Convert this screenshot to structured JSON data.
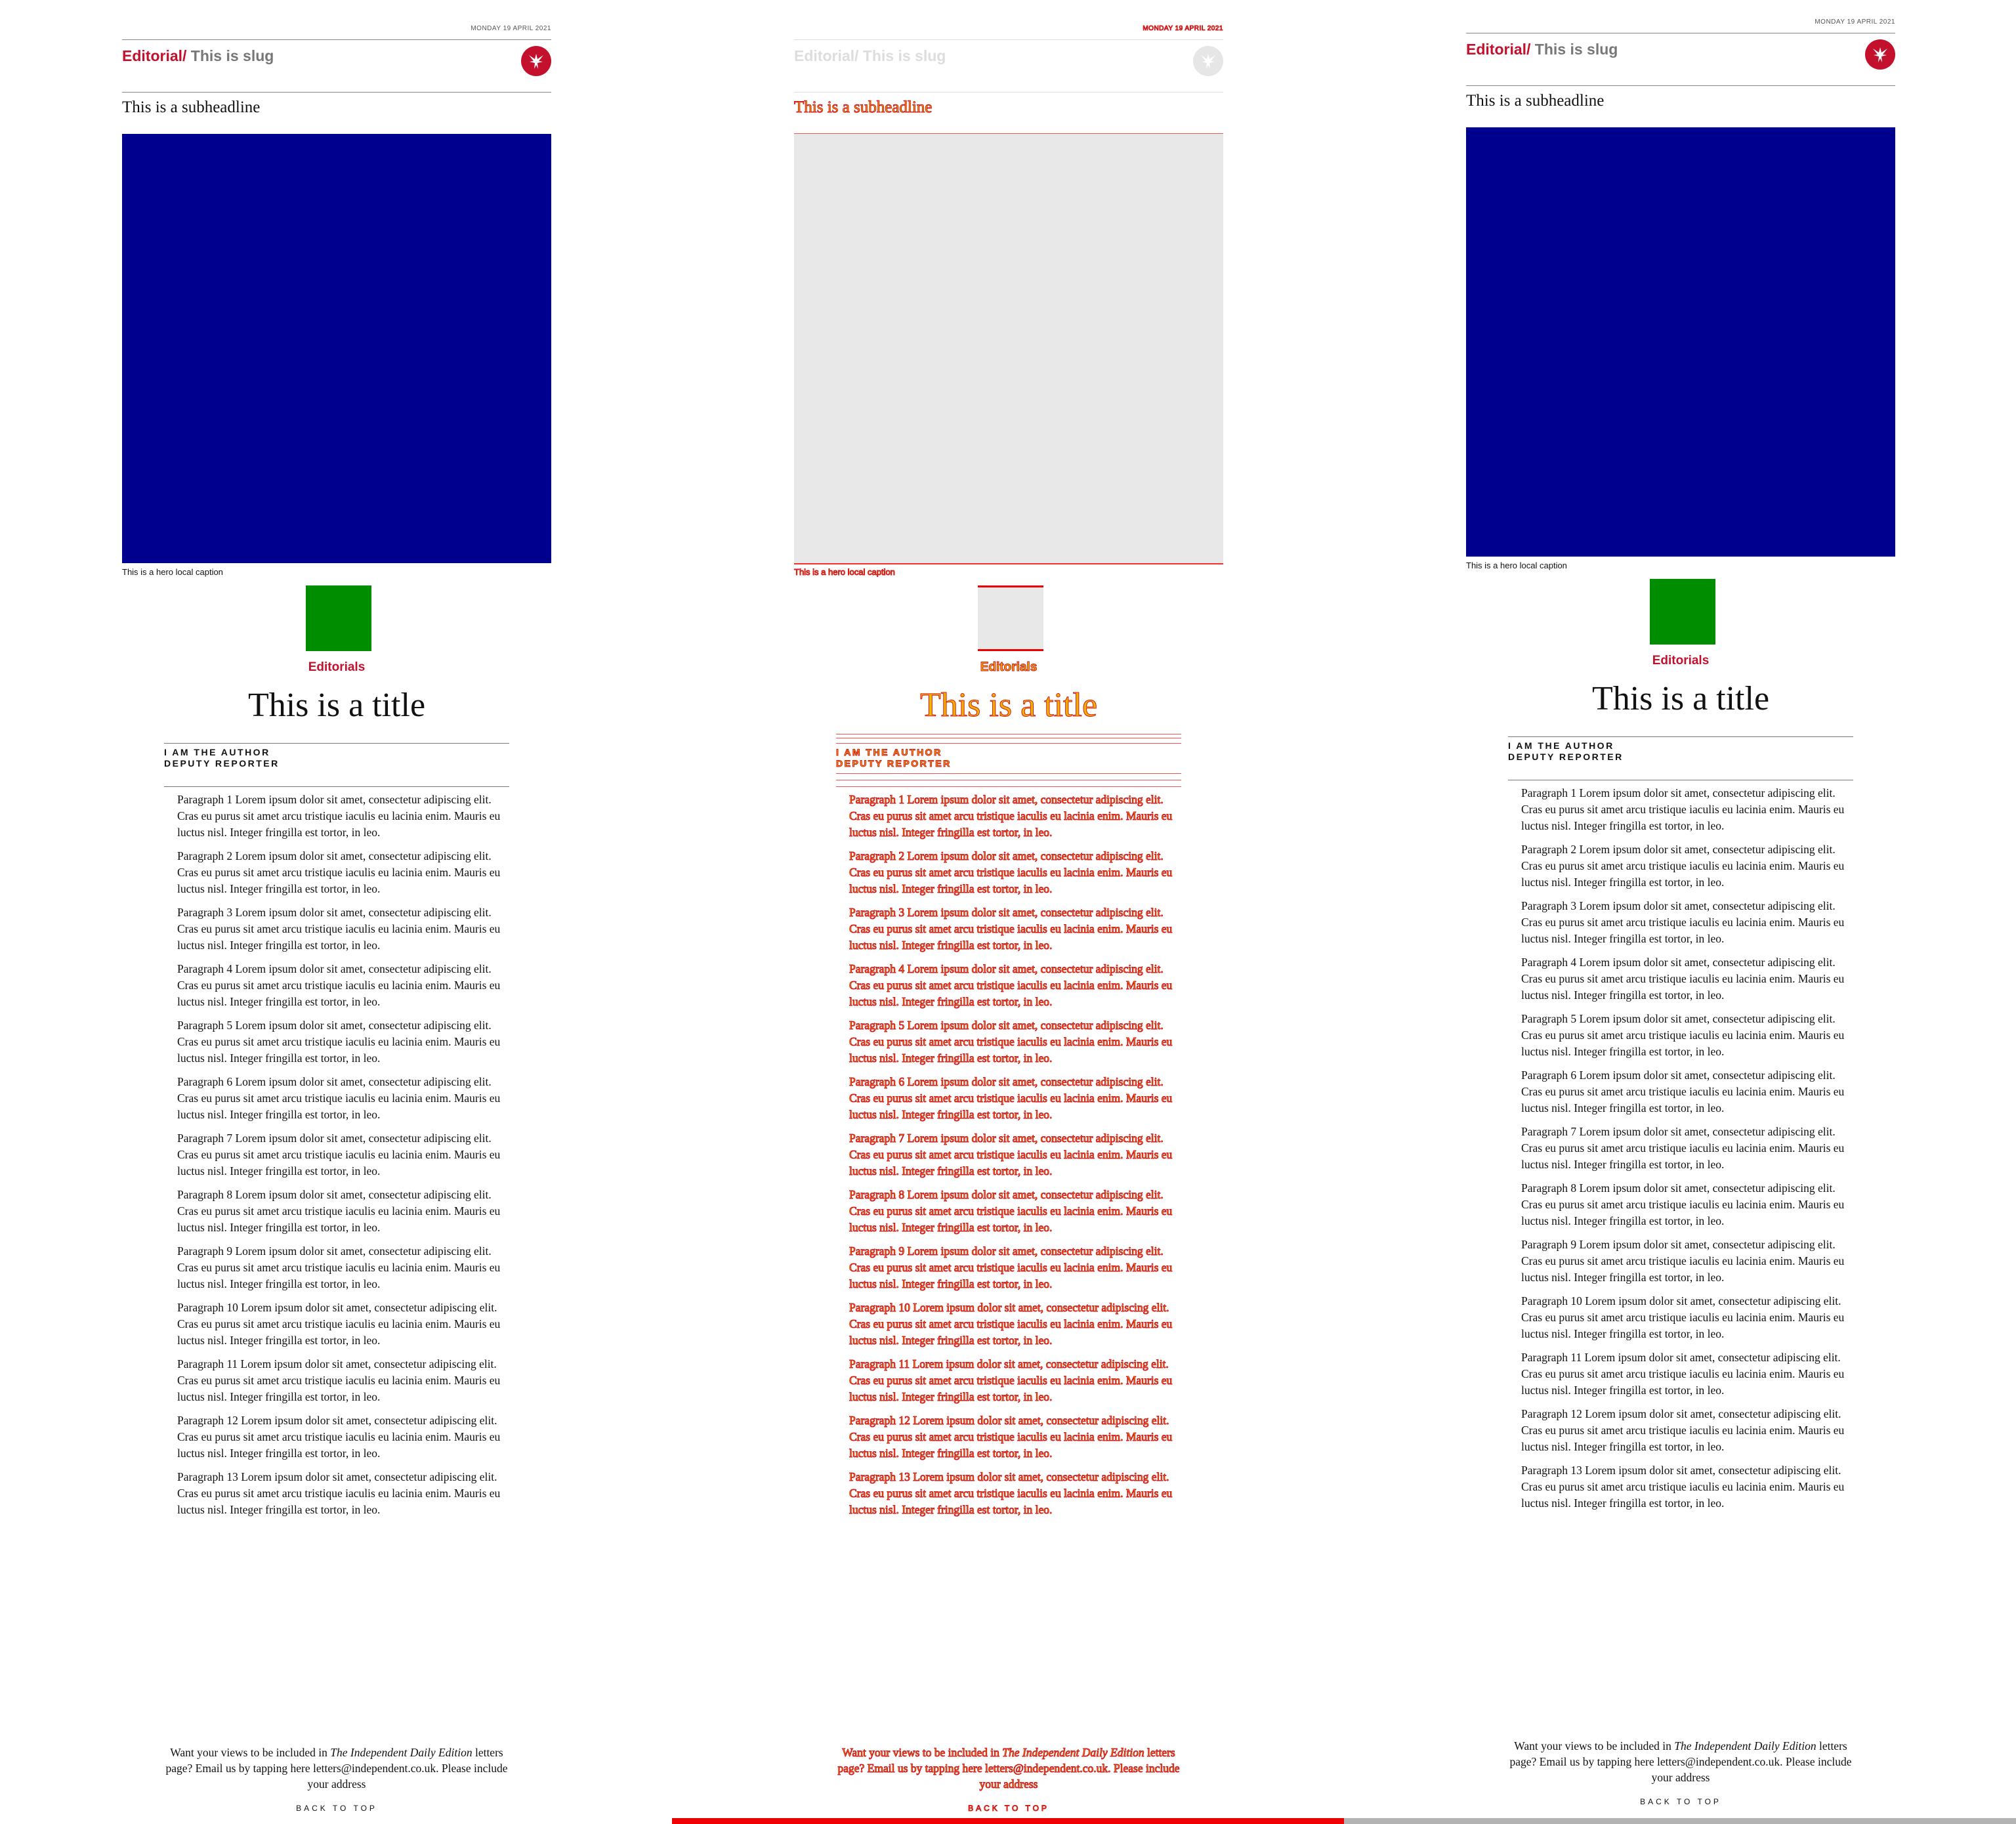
{
  "header": {
    "date": "MONDAY 19 APRIL 2021",
    "section": "Editorial",
    "separator": "/ ",
    "slug": "This is slug"
  },
  "subheadline": "This is a subheadline",
  "hero_caption": "This is a hero local caption",
  "section_label": "Editorials",
  "title": "This is a title",
  "author": {
    "name": "I AM THE AUTHOR",
    "role": "DEPUTY REPORTER"
  },
  "paragraphs": [
    "Paragraph 1 Lorem ipsum dolor sit amet, consectetur adipiscing elit. Cras eu purus sit amet arcu tristique iaculis eu lacinia enim. Mauris eu luctus nisl. Integer fringilla est tortor, in leo.",
    "Paragraph 2 Lorem ipsum dolor sit amet, consectetur adipiscing elit. Cras eu purus sit amet arcu tristique iaculis eu lacinia enim. Mauris eu luctus nisl. Integer fringilla est tortor, in leo.",
    "Paragraph 3 Lorem ipsum dolor sit amet, consectetur adipiscing elit. Cras eu purus sit amet arcu tristique iaculis eu lacinia enim. Mauris eu luctus nisl. Integer fringilla est tortor, in leo.",
    "Paragraph 4 Lorem ipsum dolor sit amet, consectetur adipiscing elit. Cras eu purus sit amet arcu tristique iaculis eu lacinia enim. Mauris eu luctus nisl. Integer fringilla est tortor, in leo.",
    "Paragraph 5 Lorem ipsum dolor sit amet, consectetur adipiscing elit. Cras eu purus sit amet arcu tristique iaculis eu lacinia enim. Mauris eu luctus nisl. Integer fringilla est tortor, in leo.",
    "Paragraph 6 Lorem ipsum dolor sit amet, consectetur adipiscing elit. Cras eu purus sit amet arcu tristique iaculis eu lacinia enim. Mauris eu luctus nisl. Integer fringilla est tortor, in leo.",
    "Paragraph 7 Lorem ipsum dolor sit amet, consectetur adipiscing elit. Cras eu purus sit amet arcu tristique iaculis eu lacinia enim. Mauris eu luctus nisl. Integer fringilla est tortor, in leo.",
    "Paragraph 8 Lorem ipsum dolor sit amet, consectetur adipiscing elit. Cras eu purus sit amet arcu tristique iaculis eu lacinia enim. Mauris eu luctus nisl. Integer fringilla est tortor, in leo.",
    "Paragraph 9 Lorem ipsum dolor sit amet, consectetur adipiscing elit. Cras eu purus sit amet arcu tristique iaculis eu lacinia enim. Mauris eu luctus nisl. Integer fringilla est tortor, in leo.",
    "Paragraph 10 Lorem ipsum dolor sit amet, consectetur adipiscing elit. Cras eu purus sit amet arcu tristique iaculis eu lacinia enim. Mauris eu luctus nisl. Integer fringilla est tortor, in leo.",
    "Paragraph 11 Lorem ipsum dolor sit amet, consectetur adipiscing elit. Cras eu purus sit amet arcu tristique iaculis eu lacinia enim. Mauris eu luctus nisl. Integer fringilla est tortor, in leo.",
    "Paragraph 12 Lorem ipsum dolor sit amet, consectetur adipiscing elit. Cras eu purus sit amet arcu tristique iaculis eu lacinia enim. Mauris eu luctus nisl. Integer fringilla est tortor, in leo.",
    "Paragraph 13 Lorem ipsum dolor sit amet, consectetur adipiscing elit. Cras eu purus sit amet arcu tristique iaculis eu lacinia enim. Mauris eu luctus nisl. Integer fringilla est tortor, in leo."
  ],
  "letters": {
    "intro": "Want your views to be included in ",
    "publication": "The Independent Daily Edition",
    "outro": " letters page? Email us by tapping here letters@independent.co.uk. Please include your address"
  },
  "back_to_top": "BACK TO TOP",
  "icons": {
    "logo": "eagle-logo-icon"
  },
  "colors": {
    "brand_red": "#c3102c",
    "hero": "#00008f",
    "thumbnail": "#008e00",
    "debug_fill": "#f2b400",
    "debug_stroke": "#d21a1a",
    "scroll_progress": "#ee0000",
    "scroll_track": "#b3b3b3"
  },
  "scroll_progress": 0.5
}
